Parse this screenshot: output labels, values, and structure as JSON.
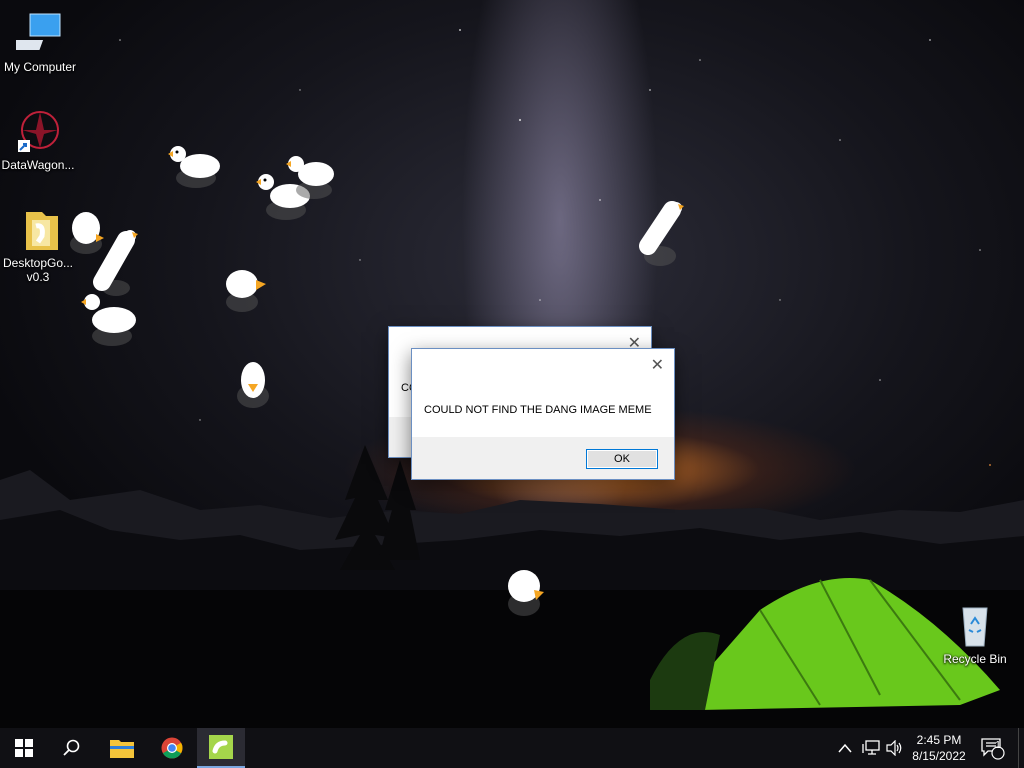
{
  "desktop_icons": [
    {
      "name": "my-computer",
      "label": "My Computer"
    },
    {
      "name": "datawagon",
      "label": "DataWagon..."
    },
    {
      "name": "desktopgoose",
      "label": "DesktopGo...",
      "label2": "v0.3"
    },
    {
      "name": "recycle-bin",
      "label": "Recycle Bin"
    }
  ],
  "dialog_back": {
    "message_partial": "CO"
  },
  "dialog_front": {
    "message": "COULD NOT FIND THE DANG IMAGE MEME",
    "ok_label": "OK",
    "close_symbol": "✕"
  },
  "taskbar": {
    "pinned": [
      "start-windows-icon",
      "search-icon",
      "file-explorer-icon",
      "chrome-icon",
      "desktop-goose-icon"
    ],
    "clock_time": "2:45 PM",
    "clock_date": "8/15/2022",
    "tray_chevron": "^",
    "notification_count": "1"
  },
  "colors": {
    "taskbar_bg": "#101014",
    "dialog_bg": "#f0f0f0",
    "ok_border": "#0078d7",
    "tent_green": "#6fd31e"
  }
}
